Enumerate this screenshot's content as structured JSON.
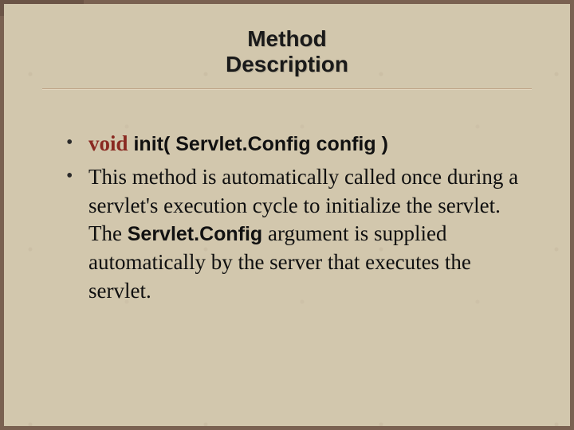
{
  "title": "Method\nDescription",
  "bullets": {
    "signature": {
      "keyword": "void",
      "rest": " init( Servlet.Config config )"
    },
    "description": {
      "pre": "This method is automatically called once during a servlet's execution cycle to initialize the servlet. The ",
      "code": "Servlet.Config",
      "post": " argument is supplied automatically by the server that executes the servlet."
    }
  }
}
